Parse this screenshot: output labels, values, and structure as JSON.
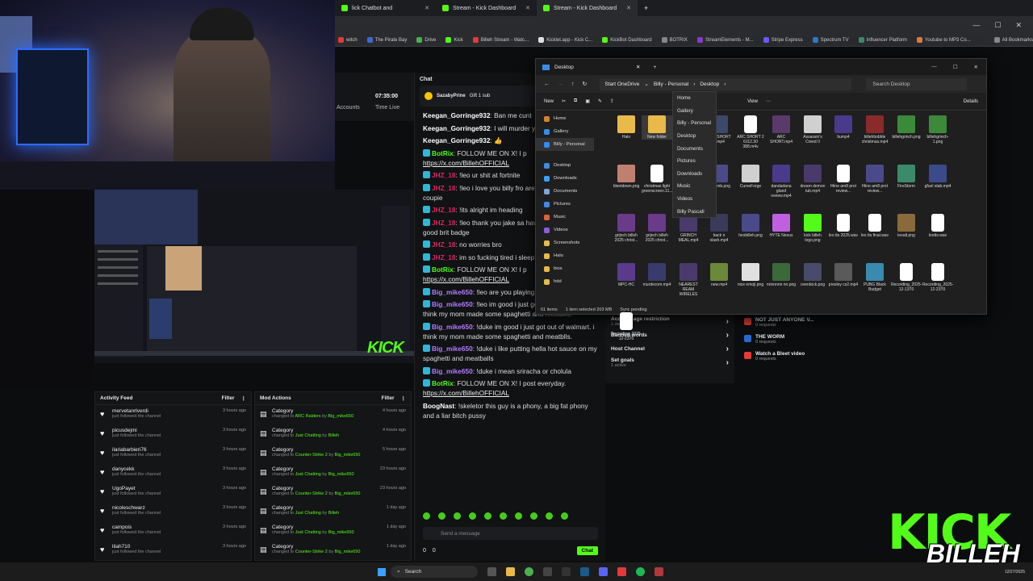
{
  "browser": {
    "tabs": [
      {
        "title": "lick Chatbot and",
        "active": false
      },
      {
        "title": "Stream - Kick Dashboard",
        "active": false
      },
      {
        "title": "Stream - Kick Dashboard",
        "active": true
      }
    ],
    "new_tab": "+",
    "bookmarks": [
      "witch",
      "The Pirate Bay",
      "Drive",
      "Kick",
      "Billeh Stream - Watc...",
      "Kicklet.app - Kick C...",
      "KickBot Dashboard",
      "BOTRIX",
      "StreamElements - M...",
      "Stripe Express",
      "Spectrum TV",
      "Influencer Platform",
      "Youtube to MP3 Co...",
      "All Bookmarks"
    ]
  },
  "dashboard_stats": {
    "time_live_value": "07:35:00",
    "time_live_label": "Time Live",
    "accounts_label": "Accounts"
  },
  "chat": {
    "title": "Chat",
    "pinned_user": "SazabyPrine",
    "pinned_text": "Gift 1 sub",
    "messages": [
      {
        "user": "Keegan_Gorringe932",
        "color": "#ffffff",
        "text": "Ban me cunt"
      },
      {
        "user": "Keegan_Gorringe932",
        "color": "#ffffff",
        "text": "I will murder y"
      },
      {
        "user": "Keegan_Gorringe932",
        "color": "#ffffff",
        "text": "👍"
      },
      {
        "user": "BotRix",
        "color": "#53fc18",
        "text": "FOLLOW ME ON X! I p",
        "link": "https://x.com/BillehOFFICIAL"
      },
      {
        "user": "JHZ_18",
        "color": "#e0245e",
        "text": "!leo ur shit at fortnite"
      },
      {
        "user": "JHZ_18",
        "color": "#e0245e",
        "text": "!leo i love you billy fro are a happily married coupie"
      },
      {
        "user": "JHZ_18",
        "color": "#e0245e",
        "text": "!its alright im heading"
      },
      {
        "user": "JHZ_18",
        "color": "#e0245e",
        "text": "!leo thank you jake sa have given him the good brit badge"
      },
      {
        "user": "JHZ_18",
        "color": "#e0245e",
        "text": "no worries bro"
      },
      {
        "user": "JHZ_18",
        "color": "#e0245e",
        "text": "im so fucking tired i sleep nights on end"
      },
      {
        "user": "BotRix",
        "color": "#53fc18",
        "text": "FOLLOW ME ON X! I p",
        "link": "https://x.com/BillehOFFICIAL"
      },
      {
        "user": "Big_mike650",
        "color": "#b37bff",
        "text": "!leo are you playing on your own mate"
      },
      {
        "user": "Big_mike650",
        "color": "#b37bff",
        "text": "!leo im good i just got out of walmart. i think my mom made some spaghetti and meatblls."
      },
      {
        "user": "Big_mike650",
        "color": "#b37bff",
        "text": "!duke im good i just got out of walmart. i think my mom made some spaghetti and meatblls."
      },
      {
        "user": "Big_mike650",
        "color": "#b37bff",
        "text": "!duke i like putting hella hot sauce on my spaghetti and meatballs"
      },
      {
        "user": "Big_mike650",
        "color": "#b37bff",
        "text": "!duke i mean sriracha or cholula"
      },
      {
        "user": "BotRix",
        "color": "#53fc18",
        "text": "FOLLOW ME ON X! I post everyday.",
        "link": "https://x.com/BillehOFFICIAL"
      },
      {
        "user": "BoogNast",
        "color": "#ffffff",
        "text": "!skeletor this guy is a phony, a big fat phony and a liar bitch pussy"
      }
    ],
    "input_placeholder": "Send a message",
    "count_left": "0",
    "count_right": "0",
    "send_label": "Chat"
  },
  "activity_feed": {
    "title": "Activity Feed",
    "filter": "Filter",
    "items": [
      {
        "name": "mervetanrlverdi",
        "sub": "just followed the channel",
        "time": "3 hours ago"
      },
      {
        "name": "picusdejmi",
        "sub": "just followed the channel",
        "time": "3 hours ago"
      },
      {
        "name": "ilariabarbieri76",
        "sub": "just followed the channel",
        "time": "3 hours ago"
      },
      {
        "name": "danycekk",
        "sub": "just followed the channel",
        "time": "3 hours ago"
      },
      {
        "name": "UgoPayet",
        "sub": "just followed the channel",
        "time": "3 hours ago"
      },
      {
        "name": "nicoleschwarz",
        "sub": "just followed the channel",
        "time": "3 hours ago"
      },
      {
        "name": "campois",
        "sub": "just followed the channel",
        "time": "3 hours ago"
      },
      {
        "name": "lilah710",
        "sub": "just followed the channel",
        "time": "3 hours ago"
      }
    ]
  },
  "mod_actions": {
    "title": "Mod Actions",
    "filter": "Filter",
    "items": [
      {
        "name": "Category",
        "sub_pre": "changed to",
        "cat": "ARC Raiders",
        "by": "by",
        "who": "Big_mike650",
        "time": "4 hours ago"
      },
      {
        "name": "Category",
        "sub_pre": "changed to",
        "cat": "Just Chatting",
        "by": "by",
        "who": "Billeh",
        "time": "4 hours ago"
      },
      {
        "name": "Category",
        "sub_pre": "changed to",
        "cat": "Counter-Strike 2",
        "by": "by",
        "who": "Big_mike650",
        "time": "5 hours ago"
      },
      {
        "name": "Category",
        "sub_pre": "changed to",
        "cat": "Just Chatting",
        "by": "by",
        "who": "Big_mike650",
        "time": "23 hours ago"
      },
      {
        "name": "Category",
        "sub_pre": "changed to",
        "cat": "Counter-Strike 2",
        "by": "by",
        "who": "Big_mike650",
        "time": "23 hours ago"
      },
      {
        "name": "Category",
        "sub_pre": "changed to",
        "cat": "Just Chatting",
        "by": "by",
        "who": "Billeh",
        "time": "1 day ago"
      },
      {
        "name": "Category",
        "sub_pre": "changed to",
        "cat": "Just Chatting",
        "by": "by",
        "who": "Big_mike650",
        "time": "1 day ago"
      },
      {
        "name": "Category",
        "sub_pre": "changed to",
        "cat": "Counter-Strike 2",
        "by": "by",
        "who": "Big_mike650",
        "time": "1 day ago"
      }
    ]
  },
  "settings": {
    "items": [
      {
        "label": "Account age restriction",
        "value": "1 day"
      },
      {
        "label": "Banned words",
        "value": ""
      },
      {
        "label": "Host Channel",
        "value": ""
      },
      {
        "label": "Set goals",
        "value": "1 active"
      }
    ]
  },
  "polls": [
    {
      "title": "NOT JUST ANYONE V...",
      "sub": "0 requests"
    },
    {
      "title": "THE WORM",
      "sub": "0 requests"
    },
    {
      "title": "Watch a Bleet video",
      "sub": "0 requests"
    }
  ],
  "explorer": {
    "title": "Desktop",
    "crumbs": [
      "Start OneDrive",
      "Billy - Personal",
      "Desktop"
    ],
    "search": "Search Desktop",
    "new_label": "New",
    "view_label": "View",
    "details_label": "Details",
    "sidebar": [
      {
        "label": "Home",
        "color": "#d9822b"
      },
      {
        "label": "Gallery",
        "color": "#2f8ff0"
      },
      {
        "label": "Billy - Personal",
        "color": "#2f8ff0"
      },
      {
        "label": "Desktop",
        "color": "#3c8ce7"
      },
      {
        "label": "Downloads",
        "color": "#3aa0ff"
      },
      {
        "label": "Documents",
        "color": "#7aa7d9"
      },
      {
        "label": "Pictures",
        "color": "#3c8ce7"
      },
      {
        "label": "Music",
        "color": "#e0603c"
      },
      {
        "label": "Videos",
        "color": "#8e5ae0"
      },
      {
        "label": "Screenshots",
        "color": "#e9b949"
      },
      {
        "label": "Halo",
        "color": "#e9b949"
      },
      {
        "label": "bios",
        "color": "#e9b949"
      },
      {
        "label": "hdd",
        "color": "#e9b949"
      }
    ],
    "files": [
      {
        "name": "Halo",
        "color": "#e9b949"
      },
      {
        "name": "New folder",
        "color": "#e9b949"
      },
      {
        "name": "ARC SHORT 2.mp4",
        "color": "#3b4a6b"
      },
      {
        "name": "ARC SHORT 2 6112.30 388.m4v",
        "color": "#ffffff"
      },
      {
        "name": "ARC SHORT.mp4",
        "color": "#5a3a6b"
      },
      {
        "name": "Assassin's Creed II",
        "color": "#d0d0d0"
      },
      {
        "name": "bump4",
        "color": "#4a3a8b"
      },
      {
        "name": "billehbobble christmas.mp4",
        "color": "#8a2a2a"
      },
      {
        "name": "billehgrinch.png",
        "color": "#3a8a3a"
      },
      {
        "name": "billehgrinch-1.png",
        "color": "#3a8a3a"
      },
      {
        "name": "bleetdown.png",
        "color": "#c08070"
      },
      {
        "name": "christmas light greenscreen.11...",
        "color": "#ffffff"
      },
      {
        "name": "coke.mp4",
        "color": "#3a3a7b"
      },
      {
        "name": "crthumb.png",
        "color": "#4a4a8b"
      },
      {
        "name": "CurseForge",
        "color": "#d0d0d0"
      },
      {
        "name": "dandadana glued review.mp4",
        "color": "#4a3a8b"
      },
      {
        "name": "dream demon tub.mp4",
        "color": "#4a3a6b"
      },
      {
        "name": "f4ine am8 prot review...",
        "color": "#ffffff"
      },
      {
        "name": "f4ine am8 prot review...",
        "color": "#4a4a8b"
      },
      {
        "name": "FireStorm",
        "color": "#3a8a6b"
      },
      {
        "name": "gfuel stab.mp4",
        "color": "#3a4a8b"
      },
      {
        "name": "grijnch billeh 2025 christ...",
        "color": "#6a3a8b"
      },
      {
        "name": "grijnch billeh 2025 christ...",
        "color": "#6a3a8b"
      },
      {
        "name": "GRINCH MEAL.mp4",
        "color": "#4a3a6b"
      },
      {
        "name": "back n slash.mp4",
        "color": "#3a3a5b"
      },
      {
        "name": "hesbilleh.png",
        "color": "#4a4a8b"
      },
      {
        "name": "HYTE Nexus",
        "color": "#c060e0"
      },
      {
        "name": "kick billeh logo.png",
        "color": "#53fc18"
      },
      {
        "name": "leo tts 2025.wav",
        "color": "#ffffff"
      },
      {
        "name": "leo tts final.wav",
        "color": "#ffffff"
      },
      {
        "name": "leoalt.png",
        "color": "#8a6a3a"
      },
      {
        "name": "leotts.wav",
        "color": "#ffffff"
      },
      {
        "name": "MPC-HC",
        "color": "#5a3a8b"
      },
      {
        "name": "murdecom.mp4",
        "color": "#3a3a6b"
      },
      {
        "name": "NEAREST REAM WIRELES",
        "color": "#4a3a6b"
      },
      {
        "name": "new.mp4",
        "color": "#6a8a3a"
      },
      {
        "name": "nice emoji.png",
        "color": "#e0e0e0"
      },
      {
        "name": "nnnnnnn nn.png",
        "color": "#3a6a3a"
      },
      {
        "name": "overdock.png",
        "color": "#4a4a6b"
      },
      {
        "name": "presley cs2.mp4",
        "color": "#5a5a5a"
      },
      {
        "name": "PUBG Black Budget",
        "color": "#3a8ab0"
      },
      {
        "name": "Recording_2025-12-13T0",
        "color": "#ffffff"
      },
      {
        "name": "Recording_2025-12-23T0",
        "color": "#ffffff"
      },
      {
        "name": "Recording_2025-12-23T0",
        "color": "#ffffff"
      }
    ],
    "status": [
      "61 items",
      "1 item selected 203 MB",
      "Sync pending"
    ]
  },
  "nav_dropdown": [
    "Home",
    "Gallery",
    "Billy - Personal",
    "Desktop",
    "Documents",
    "Pictures",
    "Downloads",
    "Music",
    "Videos",
    "Billy Pascall"
  ],
  "overlay": {
    "kick": "KICK",
    "billeh": "BILLEH",
    "small_kick": "KICK"
  },
  "taskbar": {
    "search": "Search",
    "date": "12/27/2025"
  }
}
